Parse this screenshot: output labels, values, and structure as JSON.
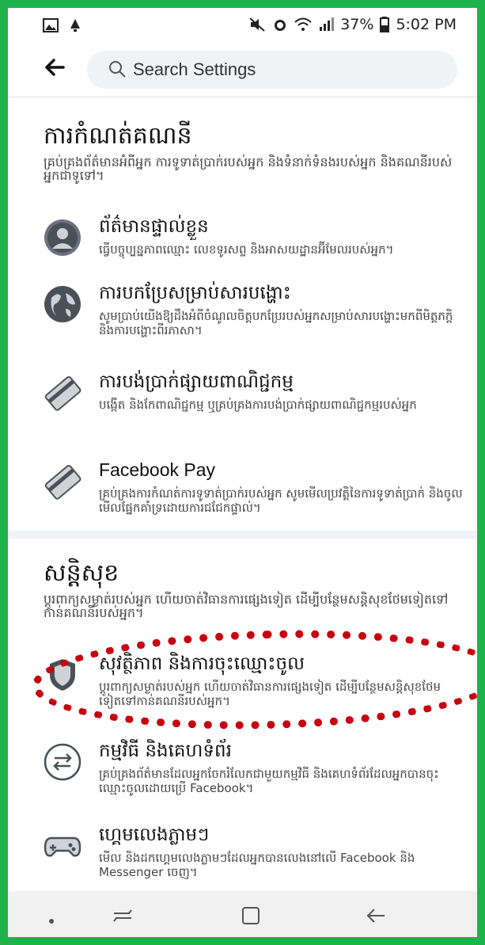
{
  "status_bar": {
    "battery": "37%",
    "time": "5:02 PM"
  },
  "header": {
    "search_placeholder": "Search Settings"
  },
  "sections": [
    {
      "title": "ការកំណត់គណនី",
      "description": "គ្រប់គ្រងព័ត៌មានអំពីអ្នក ការទូទាត់ប្រាក់របស់អ្នក និងទំនាក់ទំនងរបស់អ្នក និងគណនីរបស់អ្នកជាទូទៅ។",
      "items": [
        {
          "title": "ព័ត៌មានផ្ទាល់ខ្លួន",
          "description": "ធ្វើបច្ចុប្បន្នភាពឈ្មោះ លេខទូរសព្ទ និងអាសយដ្ឋានអ៊ីមែលរបស់អ្នក។",
          "icon": "person-icon"
        },
        {
          "title": "ការបកប្រែសម្រាប់សារបង្ហោះ",
          "description": "សូមប្រាប់យើងឱ្យដឹងអំពីចំណូលចិត្តបកប្រែរបស់អ្នកសម្រាប់សារបង្ហោះមកពីមិត្តភក្តិ និងការបង្ហោះពីរភាសា។",
          "icon": "globe-icon"
        },
        {
          "title": "ការបង់ប្រាក់ផ្សាយពាណិជ្ជកម្ម",
          "description": "បង្កើត និងកែពាណិជ្ជកម្ម ឬគ្រប់គ្រងការបង់ប្រាក់ផ្សាយពាណិជ្ជកម្មរបស់អ្នក",
          "icon": "card-icon"
        },
        {
          "title": "Facebook Pay",
          "description": "គ្រប់គ្រងការកំណត់ការទូទាត់ប្រាក់របស់អ្នក សូមមើលប្រវត្តិនៃការទូទាត់ប្រាក់ និងចូលមើលផ្នែកគាំទ្រដោយការជជែកផ្ទាល់។",
          "icon": "card-icon"
        }
      ]
    },
    {
      "title": "សន្តិសុខ",
      "description": "ប្ដូរពាក្យសម្ងាត់របស់អ្នក ហើយចាត់វិធានការផ្សេងទៀត ដើម្បីបន្ថែមសន្តិសុខថែមទៀតទៅកាន់គណនីរបស់អ្នក។",
      "items": [
        {
          "title": "សុវត្ថិភាព និងការចុះឈ្មោះចូល",
          "description": "ប្ដូរពាក្យសម្ងាត់របស់អ្នក ហើយចាត់វិធានការផ្សេងទៀត ដើម្បីបន្ថែមសន្តិសុខថែមទៀតទៅកាន់គណនីរបស់អ្នក។",
          "icon": "shield-icon"
        },
        {
          "title": "កម្មវិធី និងគេហទំព័រ",
          "description": "គ្រប់គ្រងព័ត៌មានដែលអ្នកចែករំលែកជាមួយកម្មវិធី និងគេហទំព័រដែលអ្នកបានចុះឈ្មោះចូលដោយប្រើ Facebook។",
          "icon": "arrows-icon"
        },
        {
          "title": "ហ្គេមលេងភ្លាមៗ",
          "description": "មើល និងដកហ្គេមលេងភ្លាមៗដែលអ្នកបានលេងនៅលើ Facebook និង Messenger ចេញ។",
          "icon": "gamepad-icon"
        }
      ]
    }
  ],
  "colors": {
    "frame_border": "#1db34a",
    "highlight": "#c8000f",
    "search_bg": "#f0f2f5"
  }
}
